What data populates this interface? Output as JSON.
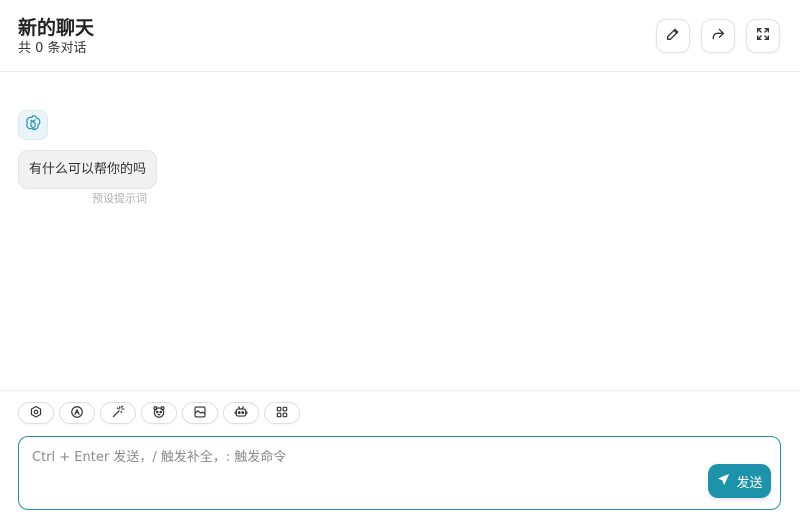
{
  "colors": {
    "accent": "#1d93ab",
    "bubble_bg": "#f1f1f1",
    "border": "#e3e3e3"
  },
  "header": {
    "title": "新的聊天",
    "subtitle": "共 0 条对话",
    "buttons": [
      {
        "icon": "pencil-icon"
      },
      {
        "icon": "share-icon"
      },
      {
        "icon": "fullscreen-icon"
      }
    ]
  },
  "chat": {
    "avatar_icon": "openai-logo-icon",
    "messages": [
      {
        "role": "assistant",
        "text": "有什么可以帮你的吗",
        "meta": "预设提示词"
      }
    ]
  },
  "toolbar": {
    "actions": [
      {
        "icon": "settings-icon"
      },
      {
        "icon": "theme-icon"
      },
      {
        "icon": "magic-wand-icon"
      },
      {
        "icon": "mask-icon"
      },
      {
        "icon": "image-icon"
      },
      {
        "icon": "robot-icon"
      },
      {
        "icon": "grid-icon"
      }
    ]
  },
  "composer": {
    "placeholder": "Ctrl + Enter 发送，/ 触发补全，: 触发命令",
    "value": "",
    "send_label": "发送"
  }
}
